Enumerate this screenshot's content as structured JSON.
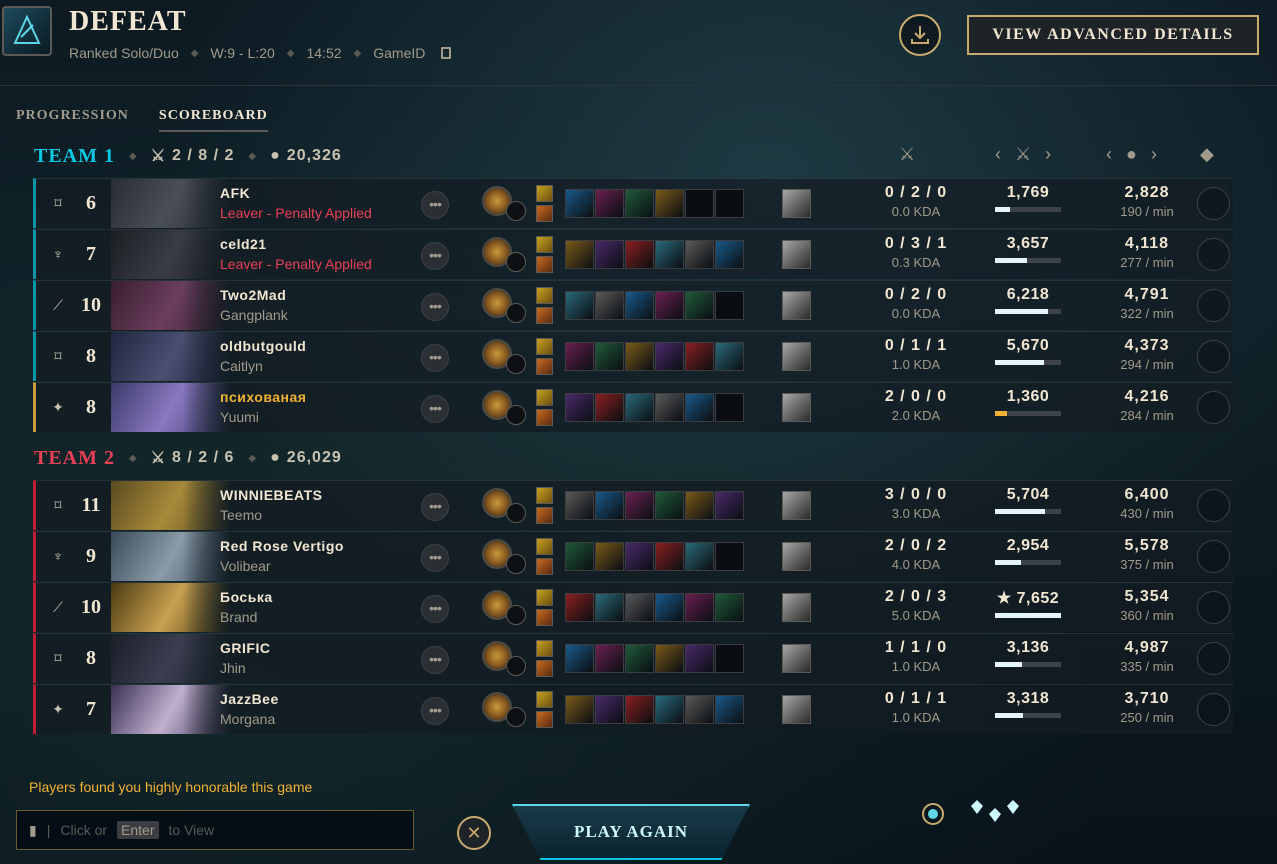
{
  "header": {
    "title": "DEFEAT",
    "queue": "Ranked Solo/Duo",
    "record": "W:9 - L:20",
    "duration": "14:52",
    "game_id_label": "GameID",
    "advanced_button": "VIEW ADVANCED DETAILS"
  },
  "tabs": [
    "PROGRESSION",
    "SCOREBOARD"
  ],
  "team1": {
    "name": "TEAM 1",
    "kda": "2 / 8 / 2",
    "gold": "20,326"
  },
  "team2": {
    "name": "TEAM 2",
    "kda": "8 / 2 / 6",
    "gold": "26,029"
  },
  "players": [
    {
      "name": "AFK",
      "sub": "Leaver - Penalty Applied",
      "leaver": true,
      "level": "6",
      "role": "jungle",
      "kda": "0 / 2 / 0",
      "kda_ratio": "0.0 KDA",
      "damage": "1,769",
      "damage_frac": 0.23,
      "gold": "2,828",
      "gpm": "190 / min"
    },
    {
      "name": "celd21",
      "sub": "Leaver - Penalty Applied",
      "leaver": true,
      "level": "7",
      "role": "top",
      "kda": "0 / 3 / 1",
      "kda_ratio": "0.3 KDA",
      "damage": "3,657",
      "damage_frac": 0.48,
      "gold": "4,118",
      "gpm": "277 / min"
    },
    {
      "name": "Two2Mad",
      "sub": "Gangplank",
      "leaver": false,
      "level": "10",
      "role": "mid",
      "kda": "0 / 2 / 0",
      "kda_ratio": "0.0 KDA",
      "damage": "6,218",
      "damage_frac": 0.81,
      "gold": "4,791",
      "gpm": "322 / min"
    },
    {
      "name": "oldbutgould",
      "sub": "Caitlyn",
      "leaver": false,
      "level": "8",
      "role": "bot",
      "kda": "0 / 1 / 1",
      "kda_ratio": "1.0 KDA",
      "damage": "5,670",
      "damage_frac": 0.74,
      "gold": "4,373",
      "gpm": "294 / min"
    },
    {
      "name": "психованая",
      "sub": "Yuumi",
      "leaver": false,
      "self": true,
      "level": "8",
      "role": "support",
      "kda": "2 / 0 / 0",
      "kda_ratio": "2.0 KDA",
      "damage": "1,360",
      "damage_frac": 0.18,
      "gold": "4,216",
      "gpm": "284 / min"
    },
    {
      "name": "WINNIEBEATS",
      "sub": "Teemo",
      "leaver": false,
      "level": "11",
      "role": "jungle",
      "kda": "3 / 0 / 0",
      "kda_ratio": "3.0 KDA",
      "damage": "5,704",
      "damage_frac": 0.75,
      "gold": "6,400",
      "gpm": "430 / min"
    },
    {
      "name": "Red Rose Vertigo",
      "sub": "Volibear",
      "leaver": false,
      "level": "9",
      "role": "top",
      "kda": "2 / 0 / 2",
      "kda_ratio": "4.0 KDA",
      "damage": "2,954",
      "damage_frac": 0.39,
      "gold": "5,578",
      "gpm": "375 / min"
    },
    {
      "name": "Боська",
      "sub": "Brand",
      "leaver": false,
      "level": "10",
      "role": "mid",
      "kda": "2 / 0 / 3",
      "kda_ratio": "5.0 KDA",
      "damage": "★ 7,652",
      "damage_frac": 1.0,
      "gold": "5,354",
      "gpm": "360 / min"
    },
    {
      "name": "GRIFIC",
      "sub": "Jhin",
      "leaver": false,
      "level": "8",
      "role": "bot",
      "kda": "1 / 1 / 0",
      "kda_ratio": "1.0 KDA",
      "damage": "3,136",
      "damage_frac": 0.41,
      "gold": "4,987",
      "gpm": "335 / min"
    },
    {
      "name": "JazzBee",
      "sub": "Morgana",
      "leaver": false,
      "level": "7",
      "role": "support",
      "kda": "0 / 1 / 1",
      "kda_ratio": "1.0 KDA",
      "damage": "3,318",
      "damage_frac": 0.43,
      "gold": "3,710",
      "gpm": "250 / min"
    }
  ],
  "footer": {
    "honor_message": "Players found you highly honorable this game",
    "chat_click": "Click or",
    "chat_key": "Enter",
    "chat_view": "to View",
    "play_again": "PLAY AGAIN"
  },
  "colors": {
    "team1": "#0a96aa",
    "team2": "#be1e37",
    "self": "#c89b3c",
    "gold": "#c8aa6e"
  },
  "icons": [
    "result-icon",
    "download-icon",
    "copy-icon",
    "kda-icon",
    "gold-icon",
    "damage-icon",
    "chevron-left-icon",
    "chevron-right-icon",
    "honor-gem-icon",
    "mute-icon",
    "close-icon"
  ]
}
